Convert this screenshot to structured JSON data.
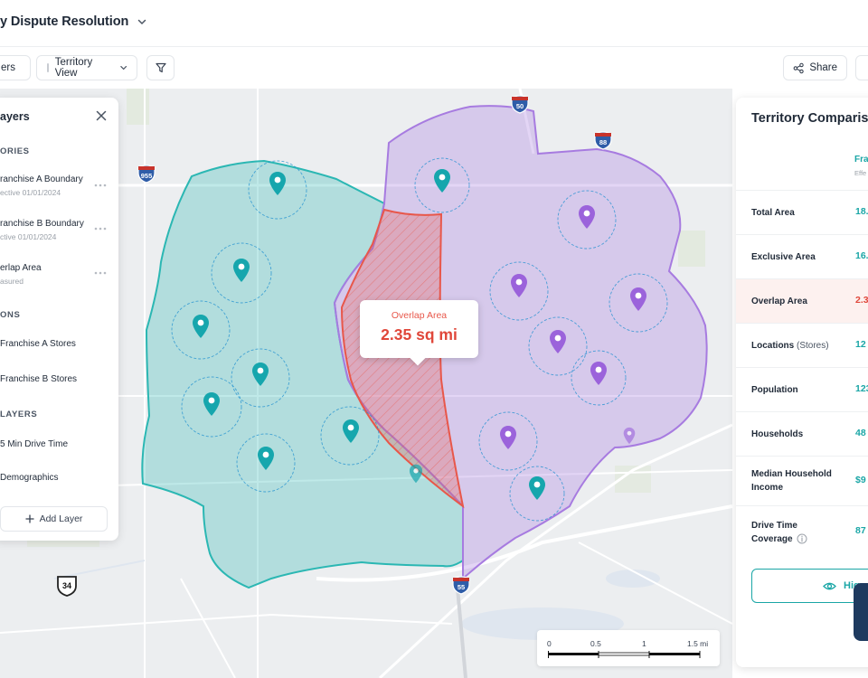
{
  "header": {
    "title": "y Dispute Resolution"
  },
  "toolbar": {
    "layers_label": "ers",
    "view_label": "Territory View",
    "share_label": "Share"
  },
  "layers_panel": {
    "title": "ayers",
    "sections": {
      "territories": "ORIES",
      "locations": "ONS",
      "context": "LAYERS"
    },
    "items": [
      {
        "label": "ranchise A Boundary",
        "sub": "ective 01/01/2024"
      },
      {
        "label": "ranchise B Boundary",
        "sub": "ctive 01/01/2024"
      },
      {
        "label": "erlap Area",
        "sub": "asured"
      },
      {
        "label": "Franchise A Stores"
      },
      {
        "label": "Franchise B Stores"
      },
      {
        "label": "5 Min Drive Time"
      },
      {
        "label": "Demographics"
      }
    ],
    "add_label": "Add Layer"
  },
  "map": {
    "callout_label": "Overlap Area",
    "callout_value": "2.35 sq mi",
    "shields": [
      "955",
      "50",
      "88",
      "34",
      "55"
    ],
    "scale": {
      "ticks": [
        "0",
        "0.5",
        "1",
        "1.5 mi"
      ]
    },
    "colors": {
      "franchise_a": "#2bb7b3",
      "franchise_b": "#a77be0",
      "overlap": "#e8574a"
    }
  },
  "comparison": {
    "title": "Territory Comparis",
    "column_head": "Fra",
    "column_sub": "Effe",
    "rows": [
      {
        "label": "Total Area",
        "value": "18."
      },
      {
        "label": "Exclusive Area",
        "value": "16."
      },
      {
        "label": "Overlap Area",
        "value": "2.3"
      },
      {
        "label": "Locations",
        "label_extra": "(Stores)",
        "value": "12"
      },
      {
        "label": "Population",
        "value": "123"
      },
      {
        "label": "Households",
        "value": "48"
      },
      {
        "label": "Median Household Income",
        "value": "$9"
      },
      {
        "label": "Drive Time Coverage",
        "value": "87"
      }
    ],
    "button_label": "Hig"
  }
}
